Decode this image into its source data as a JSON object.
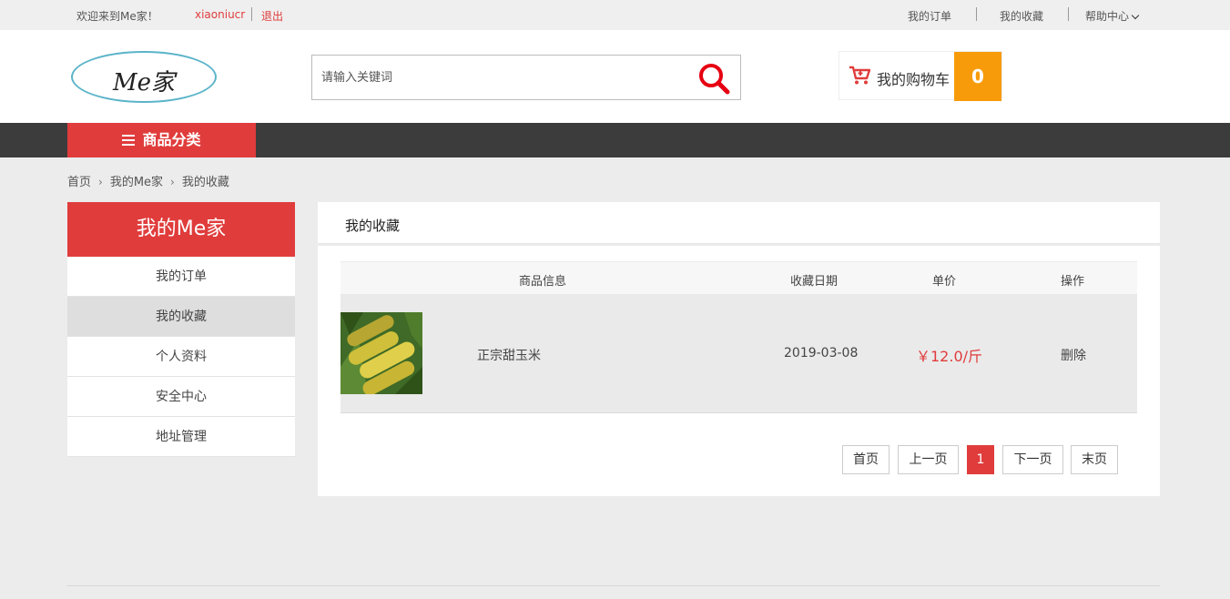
{
  "topbar": {
    "welcome": "欢迎来到Me家！",
    "username": "xiaoniucr",
    "logout": "退出",
    "my_orders": "我的订单",
    "my_favorites": "我的收藏",
    "help_center": "帮助中心"
  },
  "header": {
    "logo_text": "Me家",
    "search_placeholder": "请输入关键词",
    "cart_label": "我的购物车",
    "cart_count": "0"
  },
  "nav": {
    "category_button": "商品分类"
  },
  "breadcrumb": [
    "首页",
    "我的Me家",
    "我的收藏"
  ],
  "sidebar": {
    "title": "我的Me家",
    "items": [
      {
        "label": "我的订单"
      },
      {
        "label": "我的收藏"
      },
      {
        "label": "个人资料"
      },
      {
        "label": "安全中心"
      },
      {
        "label": "地址管理"
      }
    ],
    "active_item": "我的收藏"
  },
  "main": {
    "title": "我的收藏",
    "columns": [
      "商品信息",
      "收藏日期",
      "单价",
      "操作"
    ],
    "rows": [
      {
        "product_name": "正宗甜玉米",
        "date": "2019-03-08",
        "price": "￥12.0/斤",
        "action": "删除"
      }
    ],
    "pagination": {
      "first": "首页",
      "prev": "上一页",
      "current": "1",
      "next": "下一页",
      "last": "末页"
    }
  },
  "colors": {
    "accent_red": "#e03c3c",
    "cart_orange": "#f79b0b",
    "nav_dark": "#3c3c3c"
  }
}
